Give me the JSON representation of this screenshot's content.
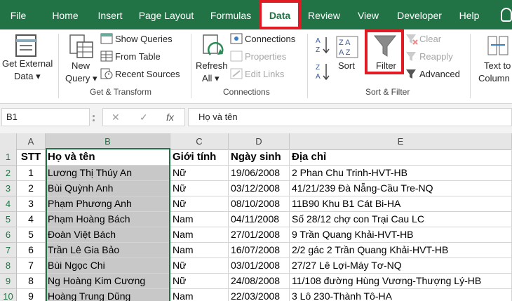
{
  "tabs": [
    {
      "label": "File"
    },
    {
      "label": "Home"
    },
    {
      "label": "Insert"
    },
    {
      "label": "Page Layout"
    },
    {
      "label": "Formulas"
    },
    {
      "label": "Data"
    },
    {
      "label": "Review"
    },
    {
      "label": "View"
    },
    {
      "label": "Developer"
    },
    {
      "label": "Help"
    }
  ],
  "ribbon": {
    "get_external_data": {
      "line1": "Get External",
      "line2": "Data ▾"
    },
    "new_query": {
      "line1": "New",
      "line2": "Query ▾"
    },
    "show_queries": "Show Queries",
    "from_table": "From Table",
    "recent_sources": "Recent Sources",
    "get_transform_label": "Get & Transform",
    "refresh_all": {
      "line1": "Refresh",
      "line2": "All ▾"
    },
    "connections": "Connections",
    "properties": "Properties",
    "edit_links": "Edit Links",
    "connections_label": "Connections",
    "sort": "Sort",
    "filter": "Filter",
    "clear": "Clear",
    "reapply": "Reapply",
    "advanced": "Advanced",
    "sort_filter_label": "Sort & Filter",
    "text_to_columns": {
      "line1": "Text to",
      "line2": "Column"
    }
  },
  "formula_bar": {
    "name_box": "B1",
    "cancel": "✕",
    "enter": "✓",
    "fx": "fx",
    "formula": "Họ và tên"
  },
  "columns": [
    "A",
    "B",
    "C",
    "D",
    "E"
  ],
  "rows": [
    "1",
    "2",
    "3",
    "4",
    "5",
    "6",
    "7",
    "8",
    "9",
    "10"
  ],
  "table": {
    "header": [
      "STT",
      "Họ và tên",
      "Giới tính",
      "Ngày sinh",
      "Địa chỉ"
    ],
    "data": [
      [
        "1",
        "Lương Thị Thúy An",
        "Nữ",
        "19/06/2008",
        "2 Phan Chu Trinh-HVT-HB"
      ],
      [
        "2",
        "Bùi Quỳnh Anh",
        "Nữ",
        "03/12/2008",
        "41/21/239 Đà Nẵng-Cầu Tre-NQ"
      ],
      [
        "3",
        "Phạm Phương Anh",
        "Nữ",
        "08/10/2008",
        "11B90 Khu B1 Cát Bi-HA"
      ],
      [
        "4",
        "Phạm Hoàng Bách",
        "Nam",
        "04/11/2008",
        "Số 28/12 chợ con Trại Cau LC"
      ],
      [
        "5",
        "Đoàn Việt Bách",
        "Nam",
        "27/01/2008",
        "9 Trần Quang Khải-HVT-HB"
      ],
      [
        "6",
        "Trần Lê Gia Bảo",
        "Nam",
        "16/07/2008",
        "2/2 gác 2 Trần Quang Khải-HVT-HB"
      ],
      [
        "7",
        "Bùi Ngọc Chi",
        "Nữ",
        "03/01/2008",
        "27/27 Lê Lợi-Máy Tơ-NQ"
      ],
      [
        "8",
        "Ng Hoàng Kim Cương",
        "Nữ",
        "24/08/2008",
        "11/108 đường Hùng Vương-Thượng Lý-HB"
      ],
      [
        "9",
        "Hoàng Trung Dũng",
        "Nam",
        "22/03/2008",
        "3 Lô 230-Thành Tô-HA"
      ]
    ]
  },
  "colors": {
    "excel_green": "#217346",
    "highlight_red": "#e01b24",
    "selected_column": "#c8c8c8"
  }
}
